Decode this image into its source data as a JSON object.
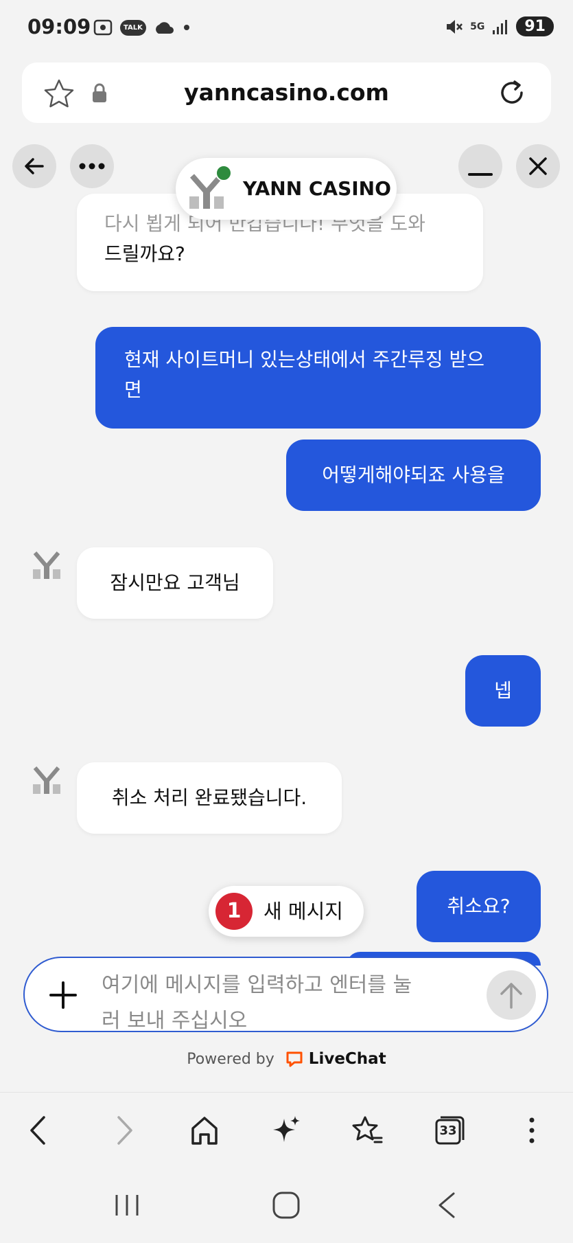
{
  "status_bar": {
    "time": "09:09",
    "talk_label": "TALK",
    "network": "5G",
    "battery": "91"
  },
  "browser": {
    "url": "yanncasino.com",
    "tabs_count": "33"
  },
  "chat_header": {
    "brand_name": "YANN CASINO",
    "online_color": "#2e8b3e"
  },
  "messages": [
    {
      "direction": "in",
      "text_line1": "다시 뵙게 되어 반갑습니다! 무엇을 도와",
      "text_line2": "드릴까요?"
    },
    {
      "direction": "out",
      "text_line1": "현재 사이트머니 있는상태에서 주간루징 받으",
      "text_line2": "면"
    },
    {
      "direction": "out",
      "text": "어떻게해야되죠 사용을"
    },
    {
      "direction": "in",
      "text": "잠시만요 고객님"
    },
    {
      "direction": "out",
      "text": "넵"
    },
    {
      "direction": "in",
      "text": "취소 처리 완료됐습니다."
    },
    {
      "direction": "out",
      "text": "취소요?"
    }
  ],
  "new_message": {
    "count": "1",
    "label": "새 메시지"
  },
  "composer": {
    "placeholder_line1": "여기에 메시지를 입력하고 엔터를 눌",
    "placeholder_line2": "러 보내 주십시오"
  },
  "footer": {
    "powered_by": "Powered by",
    "brand": "LiveChat"
  },
  "colors": {
    "outgoing": "#2457dc",
    "incoming": "#ffffff",
    "badge": "#d72634",
    "livechat_orange": "#ff5100"
  }
}
